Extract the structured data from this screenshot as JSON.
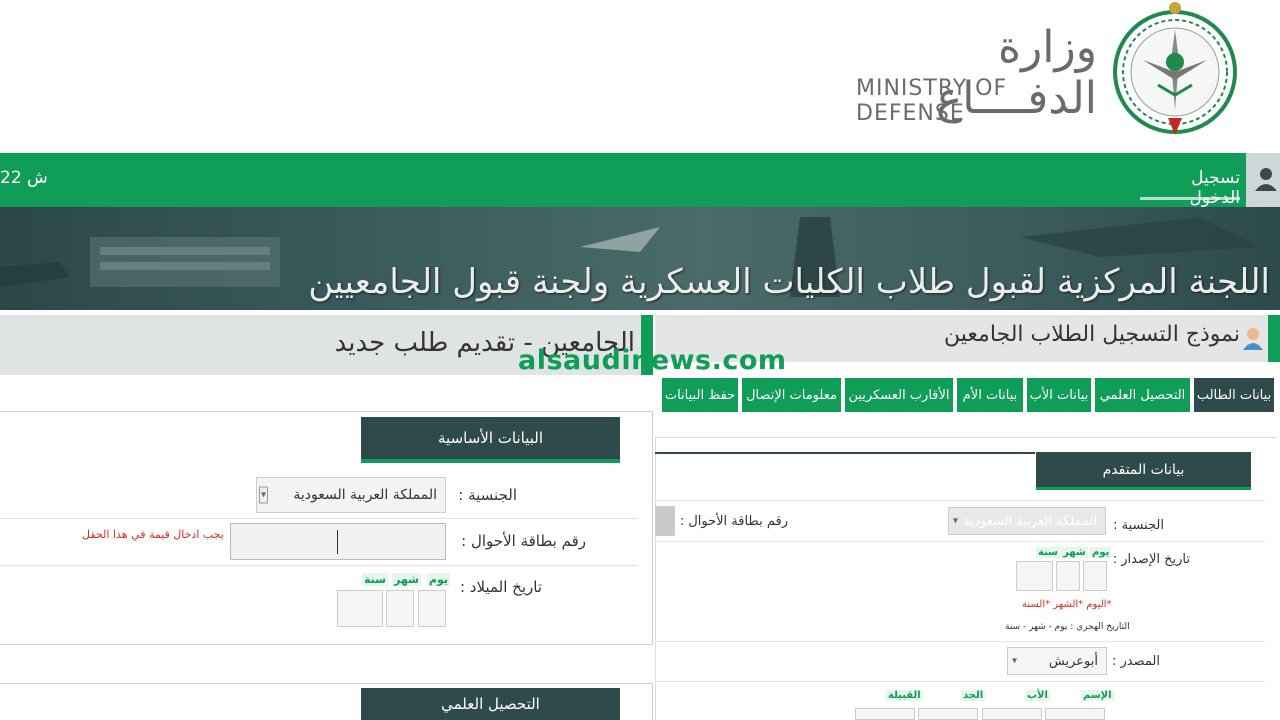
{
  "header": {
    "logo_arabic": "وزارة الدفــــاع",
    "logo_english": "MINISTRY OF DEFENSE",
    "emblem_icon": "saudi-emblem-icon"
  },
  "nav": {
    "login_label": "تسجيل الدخول",
    "date_text": "22 ش",
    "user_icon": "user-icon"
  },
  "banner": {
    "title": "اللجنة المركزية لقبول طلاب الكليات العسكرية ولجنة قبول الجامعيين"
  },
  "right_form": {
    "title": "نموذج التسجيل الطلاب الجامعين",
    "tabs": [
      {
        "label": "بيانات الطالب",
        "active": true
      },
      {
        "label": "التحصيل العلمي",
        "active": false
      },
      {
        "label": "بيانات الأب",
        "active": false
      },
      {
        "label": "بيانات الأم",
        "active": false
      },
      {
        "label": "الأقارب العسكريين",
        "active": false
      },
      {
        "label": "معلومات الإتصال",
        "active": false
      },
      {
        "label": "حفظ البيانات",
        "active": false
      }
    ],
    "section_title": "بيانات المتقدم",
    "nationality_label": "الجنسية :",
    "nationality_value": "المملكة العربية السعودية",
    "id_card_label": "رقم بطاقة الأحوال :",
    "issue_date_label": "تاريخ الإصدار :",
    "day_label": "يوم",
    "month_label": "شهر",
    "year_label": "سنة",
    "date_required_note": "*اليوم *الشهر *السنة",
    "hijri_note": "التاريخ الهجري : يوم - شهر - سنة",
    "source_label": "المصدر :",
    "source_value": "أبوعريش",
    "name_label": "الإسم",
    "father_label": "الأب",
    "grandfather_label": "الجد",
    "tribe_label": "القبيلة"
  },
  "left_form": {
    "title": "الجامعين - تقديم طلب جديد",
    "watermark": "alsaudinews.com",
    "basic_section": "البيانات الأساسية",
    "nationality_label": "الجنسية :",
    "nationality_value": "المملكة العربية السعودية",
    "id_card_label": "رقم بطاقة الأحوال :",
    "error_message": "يجب ادخال قيمة في هذا الحقل",
    "birth_date_label": "تاريخ الميلاد :",
    "day_label": "يوم",
    "month_label": "شهر",
    "year_label": "سنة",
    "education_section": "التحصيل العلمي"
  },
  "colors": {
    "brand_green": "#0f9d58",
    "dark_teal": "#2e4a4a",
    "error_red": "#d32f2f"
  }
}
